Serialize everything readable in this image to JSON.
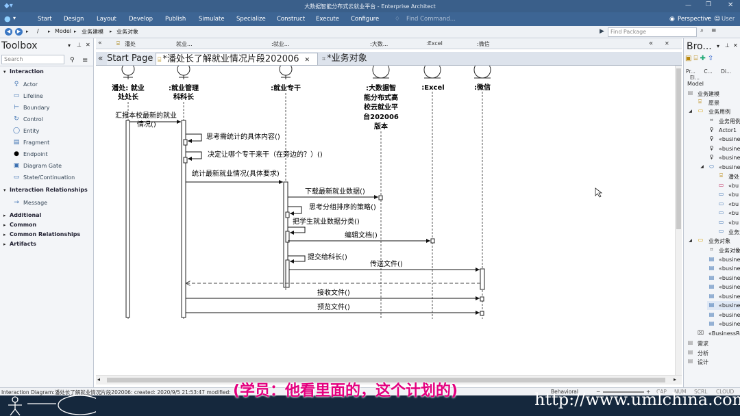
{
  "window": {
    "title": "大数据智能分布式云就业平台 - Enterprise Architect",
    "perspective": "Perspective",
    "user": "User"
  },
  "menu": [
    "Start",
    "Design",
    "Layout",
    "Develop",
    "Publish",
    "Simulate",
    "Specialize",
    "Construct",
    "Execute",
    "Configure"
  ],
  "find_command": "Find Command...",
  "breadcrumb": {
    "sep": "/",
    "items": [
      "Model",
      "业务建模",
      "业务对象"
    ]
  },
  "find_package": "Find Package",
  "toolbox": {
    "title": "Toolbox",
    "search_placeholder": "Search",
    "interaction_title": "Interaction",
    "interaction_items": [
      "Actor",
      "Lifeline",
      "Boundary",
      "Control",
      "Entity",
      "Fragment",
      "Endpoint",
      "Diagram Gate",
      "State/Continuation"
    ],
    "relationships_title": "Interaction Relationships",
    "relationships_items": [
      "Message"
    ],
    "collapsed_sections": [
      "Additional",
      "Common",
      "Common Relationships",
      "Artifacts"
    ]
  },
  "element_strip": [
    "潘处",
    "就业...",
    ":就业...",
    ":大数...",
    ":Excel",
    ":微信"
  ],
  "tabs": [
    "Start Page",
    "*潘处长了解就业情况片段202006",
    "*业务对象"
  ],
  "diagram": {
    "lifelines": [
      {
        "name": "潘处: 就业处处长",
        "kind": "actor",
        "lines": [
          "潘处: 就业",
          "处处长"
        ]
      },
      {
        "name": ":就业管理科科长",
        "kind": "actor",
        "lines": [
          ":就业管理",
          "科科长"
        ]
      },
      {
        "name": ":就业专干",
        "kind": "actor",
        "lines": [
          ":就业专干"
        ]
      },
      {
        "name": ":大数据智能分布式高校云就业平台202006版本",
        "kind": "boundary",
        "lines": [
          ":大数据智",
          "能分布式高",
          "校云就业平",
          "台202006",
          "版本"
        ]
      },
      {
        "name": ":Excel",
        "kind": "boundary",
        "lines": [
          ":Excel"
        ]
      },
      {
        "name": ":微信",
        "kind": "boundary",
        "lines": [
          ":微信"
        ]
      }
    ],
    "messages": [
      "汇报本校最新的就业情况()",
      "思考需统计的具体内容()",
      "决定让哪个专干来干（在旁边的？）()",
      "统计最新就业情况(具体要求)",
      "下载最新就业数据()",
      "思考分组排序的策略()",
      "把学生就业数据分类()",
      "编辑文档()",
      "提交给科长()",
      "传送文件()",
      "接收文件()",
      "预览文件()"
    ],
    "message_lines": {
      "m0a": "汇报本校最新的就业",
      "m0b": "情况()"
    }
  },
  "browser": {
    "title": "Bro...",
    "tabs": [
      "Pr...",
      "C...",
      "Di...",
      "El..."
    ],
    "items": [
      "Model",
      "业务建模",
      "愿景",
      "业务用例",
      "业务用例",
      "Actor1",
      "«busine",
      "«busine",
      "«busine",
      "«busine",
      "潘处",
      "«bu",
      "«bu",
      "«bu",
      "«bu",
      "«bu",
      "业务对象",
      "业务对象",
      "«busine",
      "«busine",
      "«busine",
      "«busine",
      "«busine",
      "«busine",
      "«busine",
      "«busine",
      "«BusinessRe",
      "需求",
      "分析",
      "设计"
    ]
  },
  "status": {
    "text": "Interaction Diagram:潘处长了解就业情况片段202006:  created: 2020/9/5 21:53:47  modified:",
    "percent": "0%",
    "mode": "Behavioral",
    "indicators": [
      "CAP",
      "NUM",
      "SCRL",
      "CLOUD"
    ]
  },
  "subtitle": "(学员：他看里面的，这个计划的)",
  "url": "http://www.umlchina.com",
  "colors": {
    "titlebar": "#3a5f8a",
    "menubar": "#3d6594",
    "subtitle": "#e4007f",
    "band": "#15283d"
  }
}
